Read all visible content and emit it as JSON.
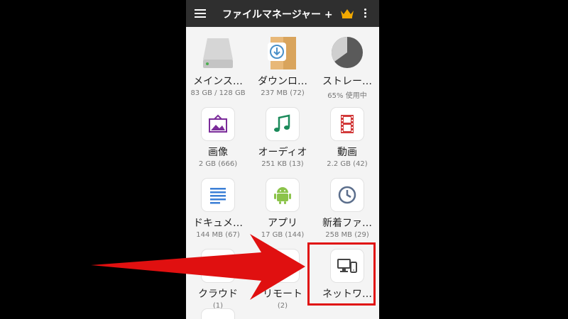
{
  "app": {
    "title": "ファイルマネージャー +",
    "menu_icon": "hamburger-menu-icon",
    "crown_icon": "crown-icon",
    "more_icon": "more-vert-icon"
  },
  "colors": {
    "appbar": "#2f2f2f",
    "crown": "#f2a900",
    "highlight": "#e01010",
    "arrow": "#e01010"
  },
  "tiles": [
    {
      "label": "メインス…",
      "sub": "83 GB / 128 GB",
      "icon": "hard-drive-icon"
    },
    {
      "label": "ダウンロ…",
      "sub": "237 MB (72)",
      "icon": "download-folder-icon"
    },
    {
      "label": "ストレー…",
      "sub": "65% 使用中",
      "icon": "storage-pie-icon",
      "usage_percent": 65
    },
    {
      "label": "画像",
      "sub": "2 GB (666)",
      "icon": "image-icon"
    },
    {
      "label": "オーディオ",
      "sub": "251 KB (13)",
      "icon": "music-note-icon"
    },
    {
      "label": "動画",
      "sub": "2.2 GB (42)",
      "icon": "film-icon"
    },
    {
      "label": "ドキュメ…",
      "sub": "144 MB (67)",
      "icon": "document-icon"
    },
    {
      "label": "アプリ",
      "sub": "17 GB (144)",
      "icon": "android-icon"
    },
    {
      "label": "新着ファ…",
      "sub": "258 MB (29)",
      "icon": "clock-icon"
    },
    {
      "label": "クラウド",
      "sub": "(1)",
      "icon": "cloud-icon"
    },
    {
      "label": "リモート",
      "sub": "(2)",
      "icon": "remote-icon"
    },
    {
      "label": "ネットワ…",
      "sub": "",
      "icon": "network-devices-icon"
    }
  ]
}
